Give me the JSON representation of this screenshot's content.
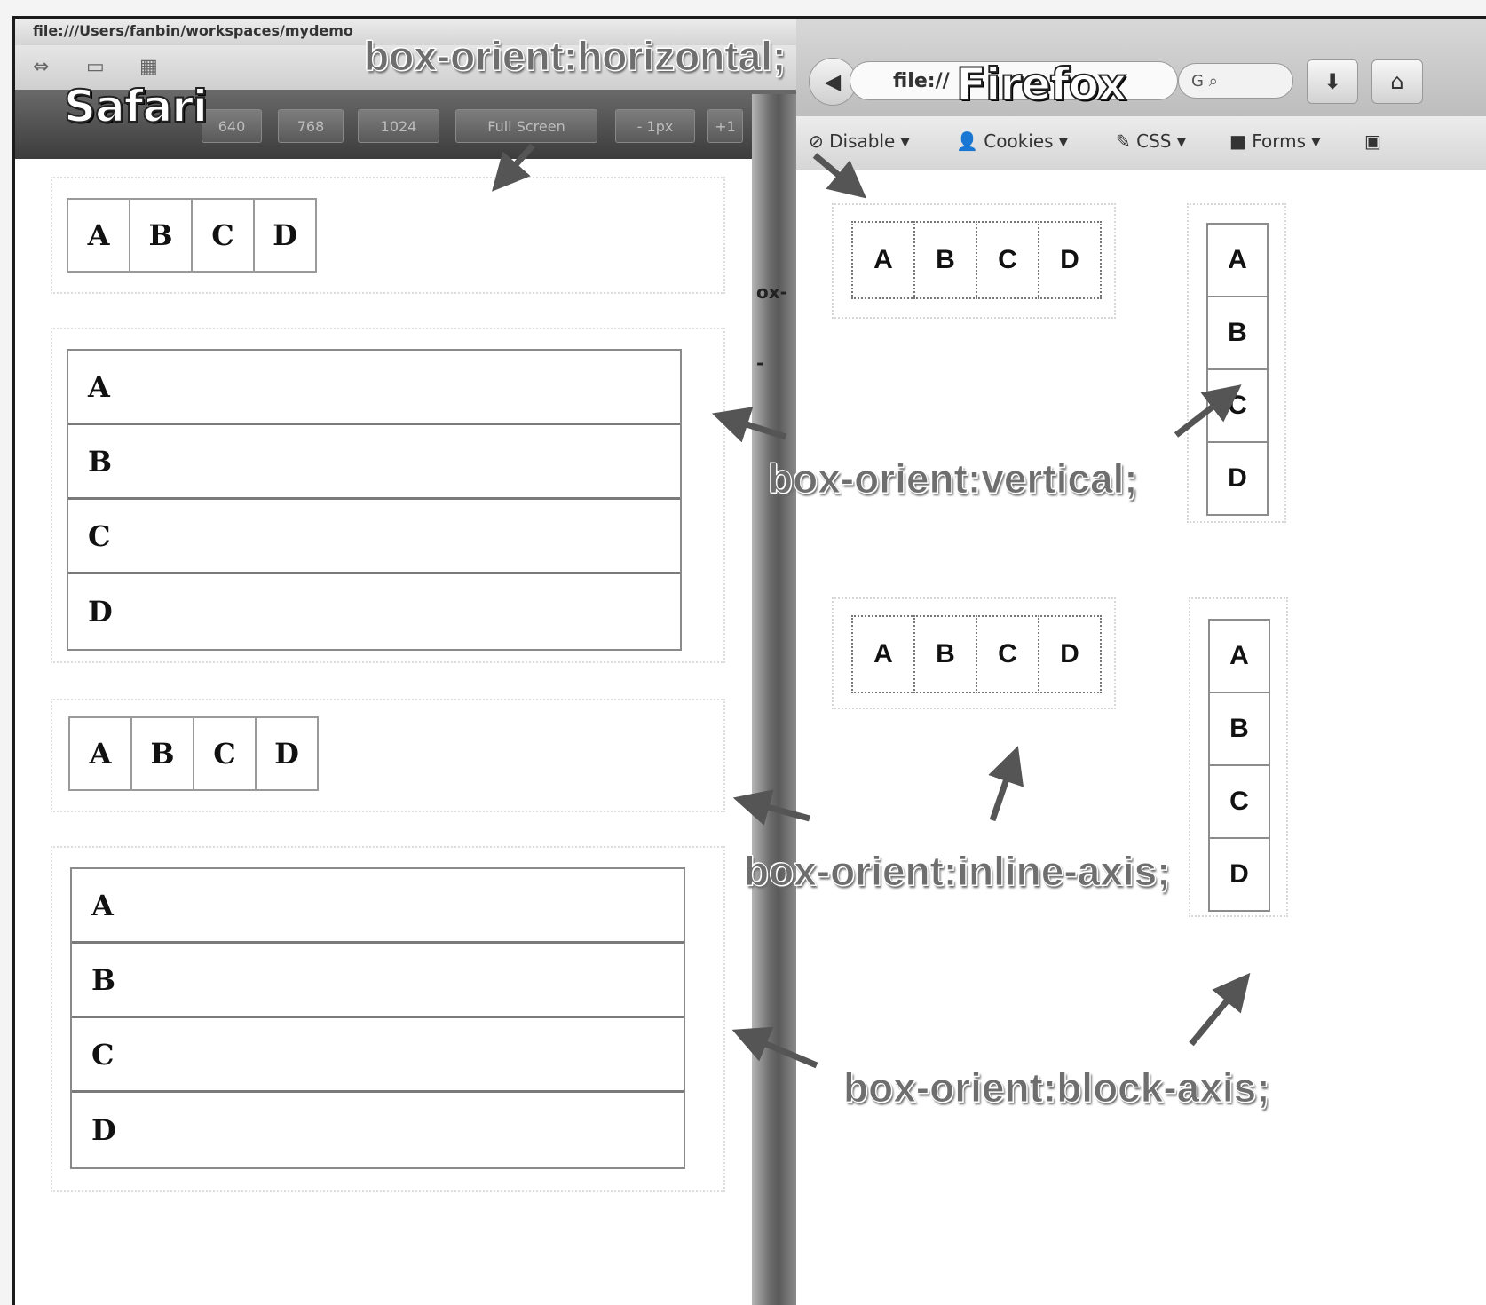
{
  "safari": {
    "title": "Safari",
    "url_text": "file:///Users/fanbin/workspaces/mydemo",
    "toolbar_buttons": [
      "640",
      "768",
      "1024",
      "Full Screen",
      "- 1px",
      "+1"
    ],
    "panels": {
      "horizontal": [
        "A",
        "B",
        "C",
        "D"
      ],
      "vertical": [
        "A",
        "B",
        "C",
        "D"
      ],
      "inline_axis": [
        "A",
        "B",
        "C",
        "D"
      ],
      "block_axis": [
        "A",
        "B",
        "C",
        "D"
      ]
    }
  },
  "firefox": {
    "title": "Firefox",
    "url_text": "file://",
    "search_text": "G",
    "devbar": [
      "Disable",
      "Cookies",
      "CSS",
      "Forms"
    ],
    "panels": {
      "horizontal": [
        "A",
        "B",
        "C",
        "D"
      ],
      "vertical": [
        "A",
        "B",
        "C",
        "D"
      ],
      "inline_axis": [
        "A",
        "B",
        "C",
        "D"
      ],
      "block_axis": [
        "A",
        "B",
        "C",
        "D"
      ]
    }
  },
  "divider_fragments": [
    "ox-",
    "-"
  ],
  "annotations": {
    "horizontal": "box-orient:horizontal;",
    "vertical": "box-orient:vertical;",
    "inline_axis": "box-orient:inline-axis;",
    "block_axis": "box-orient:block-axis;"
  }
}
